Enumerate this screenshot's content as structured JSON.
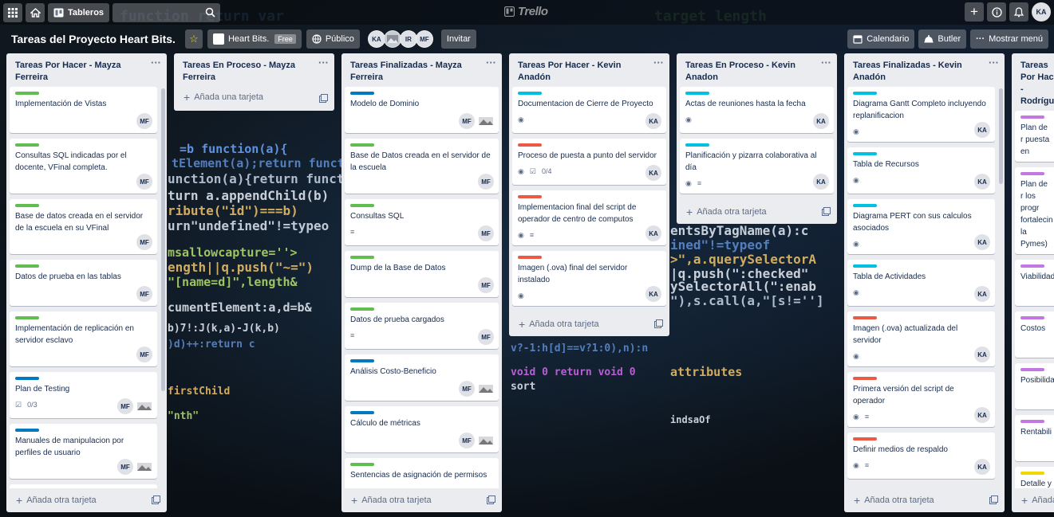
{
  "topbar": {
    "boards_label": "Tableros",
    "logo_text": "Trello",
    "user_initials": "KA"
  },
  "board": {
    "title": "Tareas del Proyecto Heart Bits.",
    "team_name": "Heart Bits.",
    "team_badge": "Free",
    "visibility": "Público",
    "members": [
      "KA",
      "",
      "IR",
      "MF"
    ],
    "invite_label": "Invitar",
    "calendar_label": "Calendario",
    "butler_label": "Butler",
    "menu_label": "Mostrar menú"
  },
  "colors": {
    "green": "#61bd4f",
    "blue": "#0079bf",
    "sky": "#00c2e0",
    "red": "#eb5a46",
    "purple": "#c377e0",
    "yellow": "#f2d600"
  },
  "lists": [
    {
      "title": "Tareas Por Hacer - Mayza Ferreira",
      "add_label": "Añada otra tarjeta",
      "cards": [
        {
          "label": "green",
          "title": "Implementación de Vistas",
          "members": [
            "MF"
          ]
        },
        {
          "label": "green",
          "title": "Consultas SQL indicadas por el docente, VFinal completa.",
          "members": [
            "MF"
          ]
        },
        {
          "label": "green",
          "title": "Base de datos creada en el servidor de la escuela en su VFinal",
          "members": [
            "MF"
          ]
        },
        {
          "label": "green",
          "title": "Datos de prueba en las tablas",
          "members": [
            "MF"
          ]
        },
        {
          "label": "green",
          "title": "Implementación de replicación en servidor esclavo",
          "members": [
            "MF"
          ]
        },
        {
          "label": "blue",
          "title": "Plan de Testing",
          "checklist": "0/3",
          "members": [
            "MF",
            "img"
          ]
        },
        {
          "label": "blue",
          "title": "Manuales de manipulacion por perfiles de usuario",
          "members": [
            "MF",
            "img"
          ]
        },
        {
          "label": "blue",
          "title": "",
          "members": []
        }
      ]
    },
    {
      "title": "Tareas En Proceso - Mayza Ferreira",
      "add_label": "Añada una tarjeta",
      "cards": []
    },
    {
      "title": "Tareas Finalizadas - Mayza Ferreira",
      "add_label": "Añada otra tarjeta",
      "cards": [
        {
          "label": "blue",
          "title": "Modelo de Dominio",
          "members": [
            "MF",
            "img"
          ]
        },
        {
          "label": "green",
          "title": "Base de Datos creada en el servidor de la escuela",
          "members": [
            "MF"
          ]
        },
        {
          "label": "green",
          "title": "Consultas SQL",
          "desc": true,
          "members": [
            "MF"
          ]
        },
        {
          "label": "green",
          "title": "Dump de la Base de Datos",
          "members": [
            "MF"
          ]
        },
        {
          "label": "green",
          "title": "Datos de prueba cargados",
          "desc": true,
          "members": [
            "MF"
          ]
        },
        {
          "label": "blue",
          "title": "Análisis Costo-Beneficio",
          "members": [
            "MF",
            "img"
          ]
        },
        {
          "label": "blue",
          "title": "Cálculo de métricas",
          "members": [
            "MF",
            "img"
          ]
        },
        {
          "label": "green",
          "title": "Sentencias de asignación de permisos",
          "members": []
        }
      ]
    },
    {
      "title": "Tareas Por Hacer - Kevin Anadón",
      "add_label": "Añada otra tarjeta",
      "cards": [
        {
          "label": "sky",
          "title": "Documentacion de Cierre de Proyecto",
          "watch": true,
          "members": [
            "KA"
          ]
        },
        {
          "label": "red",
          "title": "Proceso de puesta a punto del servidor",
          "watch": true,
          "checklist": "0/4",
          "members": [
            "KA"
          ]
        },
        {
          "label": "red",
          "title": "Implementacion final del script de operador de centro de computos",
          "watch": true,
          "desc": true,
          "members": [
            "KA"
          ]
        },
        {
          "label": "red",
          "title": "Imagen (.ova) final del servidor instalado",
          "watch": true,
          "members": [
            "KA"
          ]
        }
      ]
    },
    {
      "title": "Tareas En Proceso - Kevin Anadon",
      "add_label": "Añada otra tarjeta",
      "cards": [
        {
          "label": "sky",
          "title": "Actas de reuniones hasta la fecha",
          "watch": true,
          "members": [
            "KA"
          ]
        },
        {
          "label": "sky",
          "title": "Planificación y pizarra colaborativa al día",
          "watch": true,
          "desc": true,
          "members": [
            "KA"
          ]
        }
      ]
    },
    {
      "title": "Tareas Finalizadas - Kevin Anadón",
      "add_label": "Añada otra tarjeta",
      "cards": [
        {
          "label": "sky",
          "title": "Diagrama Gantt Completo incluyendo replanificacion",
          "watch": true,
          "members": [
            "KA"
          ]
        },
        {
          "label": "sky",
          "title": "Tabla de Recursos",
          "watch": true,
          "members": [
            "KA"
          ]
        },
        {
          "label": "sky",
          "title": "Diagrama PERT con sus calculos asociados",
          "watch": true,
          "members": [
            "KA"
          ]
        },
        {
          "label": "sky",
          "title": "Tabla de Actividades",
          "watch": true,
          "members": [
            "KA"
          ]
        },
        {
          "label": "red",
          "title": "Imagen (.ova) actualizada del servidor",
          "watch": true,
          "members": [
            "KA"
          ]
        },
        {
          "label": "red",
          "title": "Primera versión del script de operador",
          "watch": true,
          "desc": true,
          "members": [
            "KA"
          ]
        },
        {
          "label": "red",
          "title": "Definir medios de respaldo",
          "watch": true,
          "desc": true,
          "members": [
            "KA"
          ]
        }
      ]
    },
    {
      "title": "Tareas Por Hacer - Rodrígue",
      "add_label": "Añada",
      "cards": [
        {
          "label": "purple",
          "title": "Plan de r puesta en",
          "members": []
        },
        {
          "label": "purple",
          "title": "Plan de r los progr fortalecin la Pymes)",
          "members": []
        },
        {
          "label": "purple",
          "title": "Viabilidad",
          "members": []
        },
        {
          "label": "purple",
          "title": "Costos",
          "members": []
        },
        {
          "label": "purple",
          "title": "Posibilida",
          "members": []
        },
        {
          "label": "purple",
          "title": "Rentabili",
          "members": []
        },
        {
          "label": "yellow",
          "title": "Detalle y implemen informati",
          "members": []
        }
      ]
    }
  ]
}
